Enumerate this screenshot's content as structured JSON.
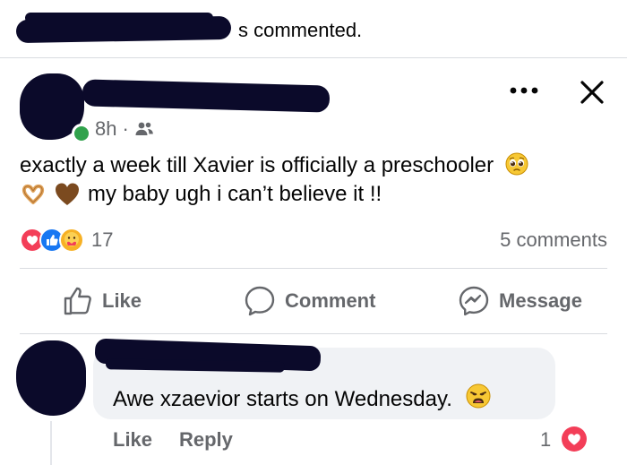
{
  "activity": {
    "text": "s commented."
  },
  "post": {
    "time": "8h",
    "separator": "·",
    "audience_icon": "friends-icon",
    "line1": "exactly a week till Xavier is officially a preschooler",
    "line2": "my baby ugh i can’t believe it !!",
    "emojis": [
      "pleading-face",
      "heart-hands",
      "brown-heart"
    ]
  },
  "reactions": {
    "types": [
      "love",
      "like",
      "care"
    ],
    "count": "17",
    "comments": "5 comments"
  },
  "actions": {
    "like": "Like",
    "comment": "Comment",
    "message": "Message"
  },
  "comment": {
    "text": "Awe xzaevior starts on Wednesday.",
    "emoji": "weary-face",
    "like": "Like",
    "reply": "Reply",
    "reaction_count": "1",
    "reaction_type": "love"
  },
  "colors": {
    "like_blue": "#1877f2",
    "love_red": "#f33e58",
    "care_yellow": "#f7b125",
    "muted": "#65676b",
    "bubble": "#f0f2f5",
    "online_green": "#31a24c"
  }
}
